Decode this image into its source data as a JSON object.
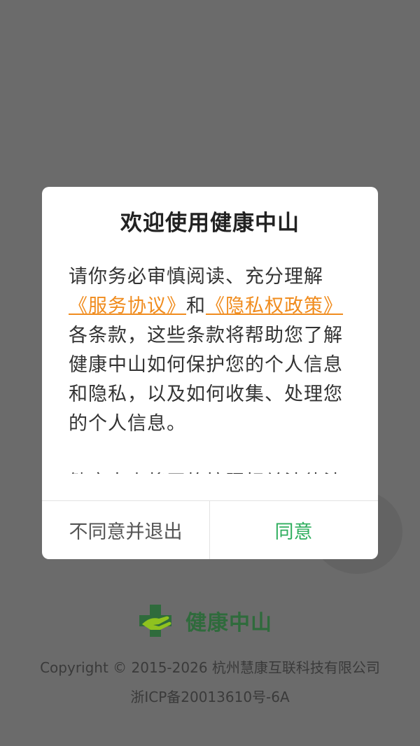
{
  "dialog": {
    "title": "欢迎使用健康中山",
    "body_prefix": "请你务必审慎阅读、充分理解",
    "link_service": "《服务协议》",
    "body_and": "和",
    "link_privacy": "《隐私权政策》",
    "body_rest": "各条款，这些条款将帮助您了解健康中山如何保护您的个人信息和隐私，以及如何收集、处理您的个人信息。",
    "body_para2": "健康中山将严格按照相关法律法规",
    "decline_label": "不同意并退出",
    "agree_label": "同意",
    "link_color": "#f08c1e",
    "agree_color": "#2fae5e"
  },
  "footer": {
    "brand_name": "健康中山",
    "logo_icon": "health-cross-hand-logo",
    "copyright": "Copyright © 2015-2026 杭州慧康互联科技有限公司",
    "icp": "浙ICP备20013610号-6A"
  }
}
